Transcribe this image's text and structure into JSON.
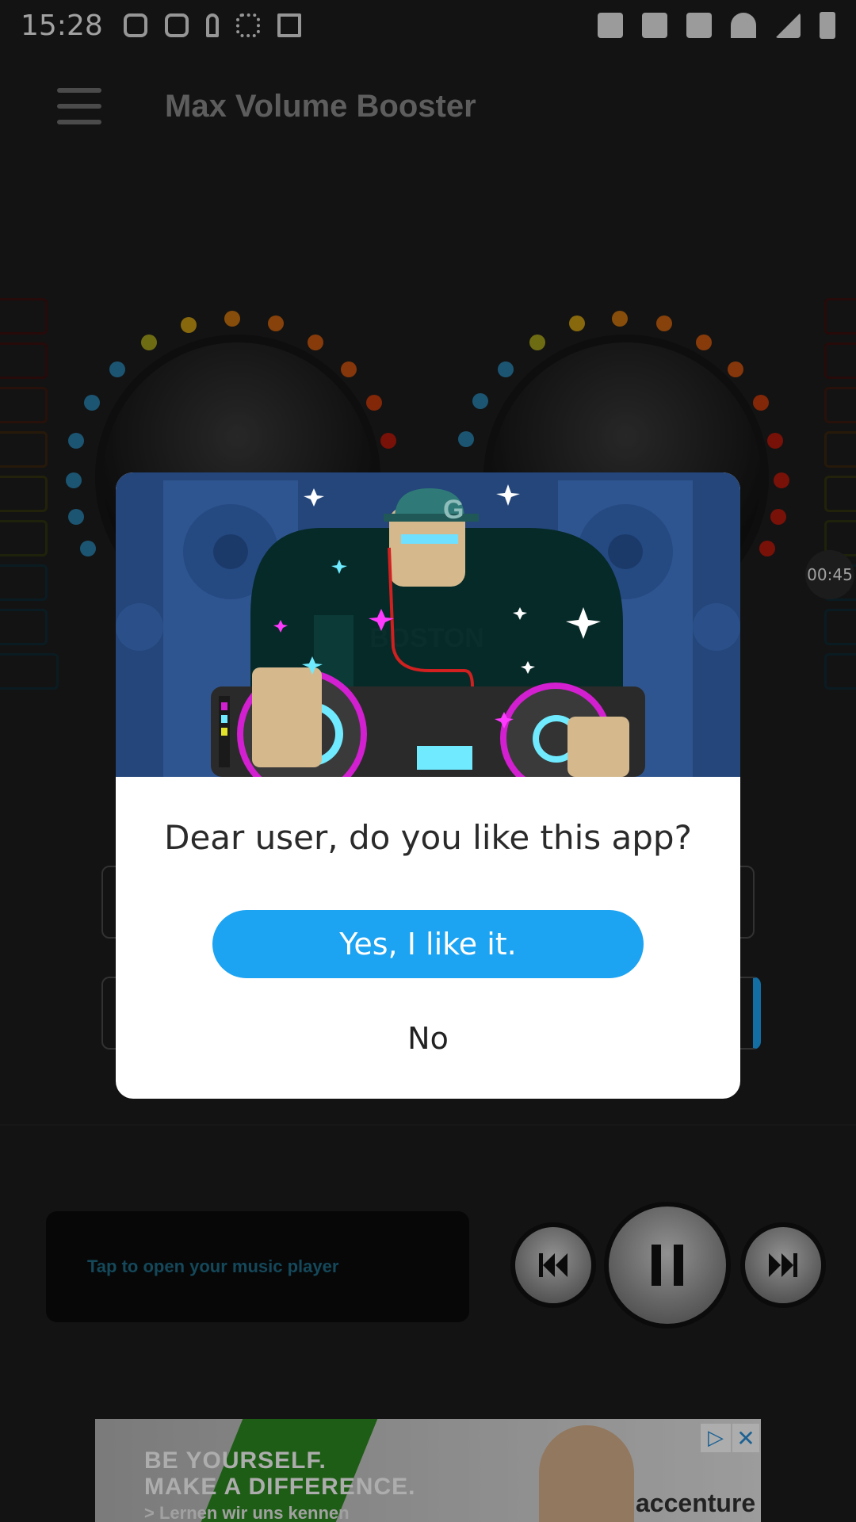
{
  "status_bar": {
    "time": "15:28"
  },
  "app_bar": {
    "title": "Max Volume Booster"
  },
  "timer_badge": "00:45",
  "music_player": {
    "prompt": "Tap to open your music player"
  },
  "dialog": {
    "illustration_text": "BOSTON",
    "cap_letter": "G",
    "question": "Dear user, do you like this app?",
    "yes_label": "Yes, I like it.",
    "no_label": "No"
  },
  "ad": {
    "line1": "BE YOURSELF.",
    "line2": "MAKE A DIFFERENCE.",
    "line3": "> Lernen wir uns kennen",
    "brand": "accenture",
    "close_symbol": "✕",
    "adchoices_symbol": "▷"
  },
  "colors": {
    "accent_button": "#1ca3f2",
    "music_player_text": "#1e6a85",
    "ad_green": "#2d8a1f"
  }
}
